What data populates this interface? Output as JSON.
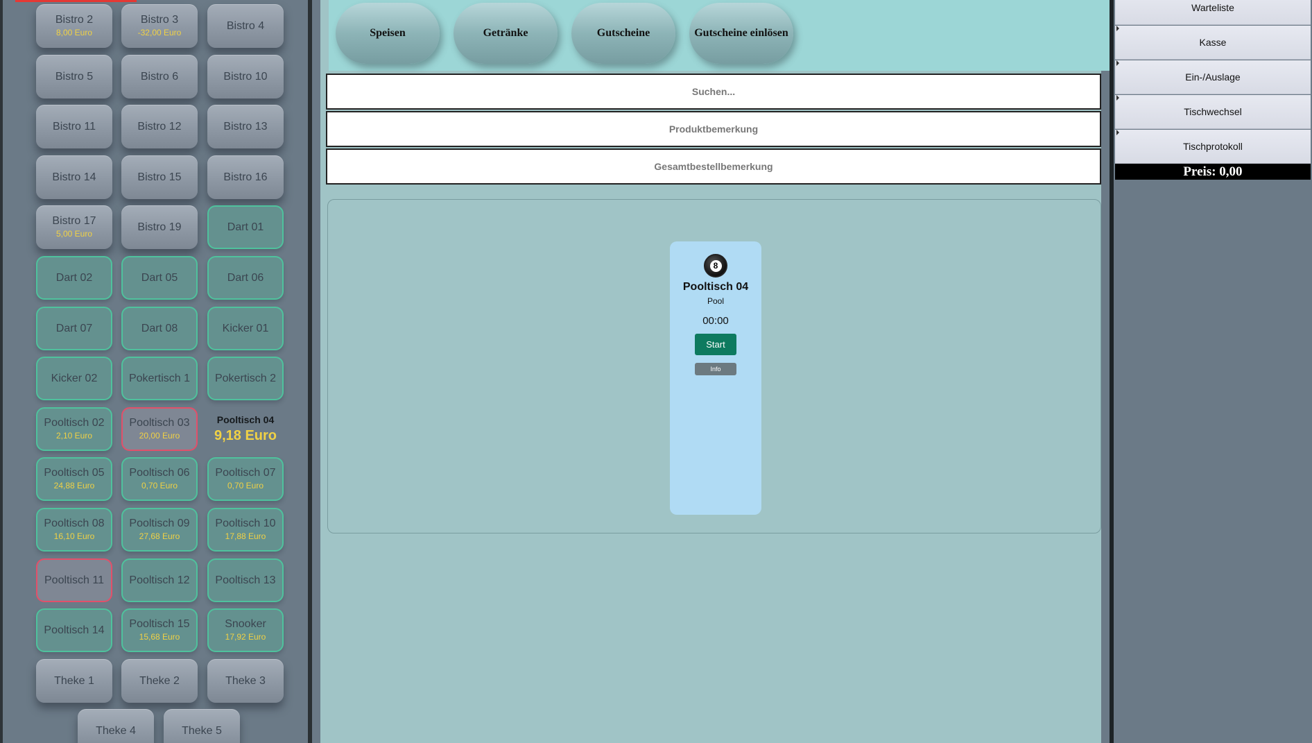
{
  "tables": [
    {
      "name": "Bistro 2",
      "price": "8,00 Euro",
      "style": "grey"
    },
    {
      "name": "Bistro 3",
      "price": "-32,00 Euro",
      "style": "grey"
    },
    {
      "name": "Bistro 4",
      "price": "",
      "style": "grey"
    },
    {
      "name": "Bistro 5",
      "price": "",
      "style": "grey"
    },
    {
      "name": "Bistro 6",
      "price": "",
      "style": "grey"
    },
    {
      "name": "Bistro 10",
      "price": "",
      "style": "grey"
    },
    {
      "name": "Bistro 11",
      "price": "",
      "style": "grey"
    },
    {
      "name": "Bistro 12",
      "price": "",
      "style": "grey"
    },
    {
      "name": "Bistro 13",
      "price": "",
      "style": "grey"
    },
    {
      "name": "Bistro 14",
      "price": "",
      "style": "grey"
    },
    {
      "name": "Bistro 15",
      "price": "",
      "style": "grey"
    },
    {
      "name": "Bistro 16",
      "price": "",
      "style": "grey"
    },
    {
      "name": "Bistro 17",
      "price": "5,00 Euro",
      "style": "grey"
    },
    {
      "name": "Bistro 19",
      "price": "",
      "style": "grey"
    },
    {
      "name": "Dart 01",
      "price": "",
      "style": "green"
    },
    {
      "name": "Dart 02",
      "price": "",
      "style": "green"
    },
    {
      "name": "Dart 05",
      "price": "",
      "style": "green"
    },
    {
      "name": "Dart 06",
      "price": "",
      "style": "green"
    },
    {
      "name": "Dart 07",
      "price": "",
      "style": "green"
    },
    {
      "name": "Dart 08",
      "price": "",
      "style": "green"
    },
    {
      "name": "Kicker 01",
      "price": "",
      "style": "green"
    },
    {
      "name": "Kicker 02",
      "price": "",
      "style": "green"
    },
    {
      "name": "Pokertisch 1",
      "price": "",
      "style": "green"
    },
    {
      "name": "Pokertisch 2",
      "price": "",
      "style": "green"
    },
    {
      "name": "Pooltisch 02",
      "price": "2,10 Euro",
      "style": "green"
    },
    {
      "name": "Pooltisch 03",
      "price": "20,00 Euro",
      "style": "red"
    },
    {
      "name": "Pooltisch 04",
      "price": "9,18 Euro",
      "style": "selected"
    },
    {
      "name": "Pooltisch 05",
      "price": "24,88 Euro",
      "style": "green"
    },
    {
      "name": "Pooltisch 06",
      "price": "0,70 Euro",
      "style": "green"
    },
    {
      "name": "Pooltisch 07",
      "price": "0,70 Euro",
      "style": "green"
    },
    {
      "name": "Pooltisch 08",
      "price": "16,10 Euro",
      "style": "green"
    },
    {
      "name": "Pooltisch 09",
      "price": "27,68 Euro",
      "style": "green"
    },
    {
      "name": "Pooltisch 10",
      "price": "17,88 Euro",
      "style": "green"
    },
    {
      "name": "Pooltisch 11",
      "price": "",
      "style": "red"
    },
    {
      "name": "Pooltisch 12",
      "price": "",
      "style": "green"
    },
    {
      "name": "Pooltisch 13",
      "price": "",
      "style": "green"
    },
    {
      "name": "Pooltisch 14",
      "price": "",
      "style": "green"
    },
    {
      "name": "Pooltisch 15",
      "price": "15,68 Euro",
      "style": "green"
    },
    {
      "name": "Snooker",
      "price": "17,92 Euro",
      "style": "green"
    },
    {
      "name": "Theke 1",
      "price": "",
      "style": "grey"
    },
    {
      "name": "Theke 2",
      "price": "",
      "style": "grey"
    },
    {
      "name": "Theke 3",
      "price": "",
      "style": "grey"
    },
    {
      "name": "Theke 4",
      "price": "",
      "style": "grey"
    },
    {
      "name": "Theke 5",
      "price": "",
      "style": "grey"
    }
  ],
  "categories": [
    "Speisen",
    "Getränke",
    "Gutscheine",
    "Gutscheine einlösen"
  ],
  "search": {
    "placeholder": "Suchen..."
  },
  "product_note": {
    "placeholder": "Produktbemerkung"
  },
  "order_note": {
    "placeholder": "Gesamtbestellbemerkung"
  },
  "table_card": {
    "ball_number": "8",
    "name": "Pooltisch 04",
    "type": "Pool",
    "timer": "00:00",
    "start_label": "Start",
    "info_label": "Info"
  },
  "actions": [
    "Warteliste",
    "Kasse",
    "Ein-/Auslage",
    "Tischwechsel",
    "Tischprotokoll"
  ],
  "price_total": "Preis: 0,00",
  "colors": {
    "panel_grey": "#6b7a87",
    "main_bg": "#a0c4c6",
    "category_bar": "#9cd6d6",
    "occupied_border": "#4fc29d",
    "alert_border": "#e2506a",
    "price_text": "#f0d145",
    "start_button": "#0d7a5f",
    "card_bg": "#b0dbf4"
  }
}
